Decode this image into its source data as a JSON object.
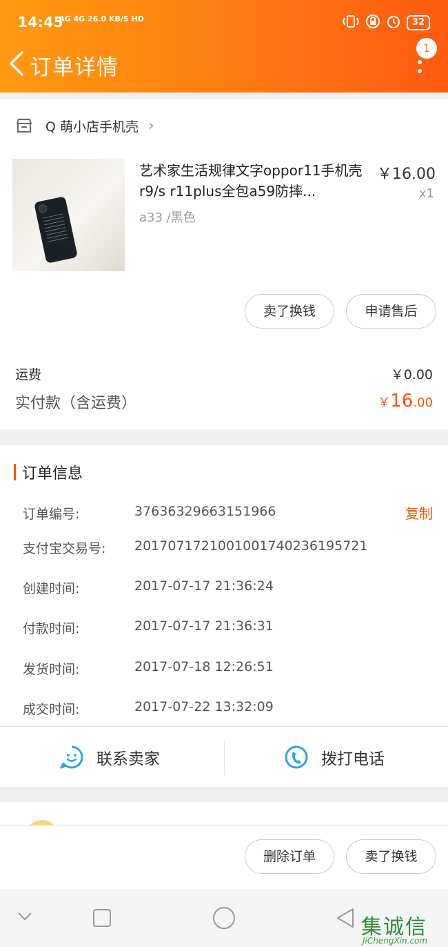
{
  "status_bar": {
    "time": "14:45",
    "network": "4G 4G 26.0 KB/S HD",
    "battery": "32"
  },
  "nav": {
    "title": "订单详情",
    "badge_count": "1"
  },
  "shop": {
    "name": "Q 萌小店手机壳"
  },
  "product": {
    "title": "艺术家生活规律文字oppor11手机壳r9/s r11plus全包a59防摔...",
    "price": "￥16.00",
    "qty": "x1",
    "sku": "a33 /黑色",
    "actions": [
      "卖了换钱",
      "申请售后"
    ]
  },
  "payment": {
    "shipping_label": "运费",
    "shipping_value": "￥0.00",
    "total_label": "实付款（含运费）",
    "total_currency": "￥",
    "total_int": "16",
    "total_dec": ".00"
  },
  "order_info": {
    "title": "订单信息",
    "copy_label": "复制",
    "rows": [
      {
        "label": "订单编号:",
        "value": "37636329663151966"
      },
      {
        "label": "支付宝交易号:",
        "value": "2017071721001001740236195721"
      },
      {
        "label": "创建时间:",
        "value": "2017-07-17 21:36:24"
      },
      {
        "label": "付款时间:",
        "value": "2017-07-17 21:36:31"
      },
      {
        "label": "发货时间:",
        "value": "2017-07-18 12:26:51"
      },
      {
        "label": "成交时间:",
        "value": "2017-07-22 13:32:09"
      }
    ]
  },
  "contact": {
    "seller_label": "联系卖家",
    "phone_label": "拨打电话"
  },
  "bottom_actions": [
    "删除订单",
    "卖了换钱"
  ],
  "watermark": {
    "main": "集诚信",
    "sub": "JiChengXin.com"
  },
  "colors": {
    "accent": "#ff5000",
    "header_start": "#ff9a10",
    "header_end": "#ff5a10",
    "contact_icon": "#2aa7e0"
  }
}
